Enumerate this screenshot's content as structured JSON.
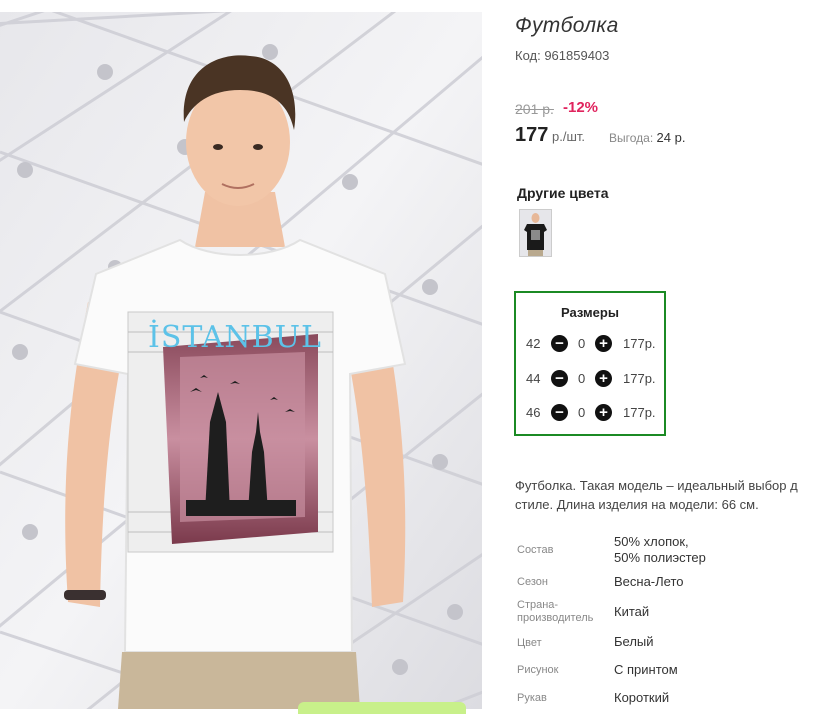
{
  "product": {
    "title": "Футболка",
    "code": "Код: 961859403"
  },
  "pricing": {
    "old_price": "201 р.",
    "discount": "-12%",
    "price": "177",
    "unit": "р./шт.",
    "benefit_label": "Выгода:",
    "benefit_value": "24 р."
  },
  "colors": {
    "title": "Другие цвета",
    "swatches": [
      "black-tshirt"
    ]
  },
  "sizes": {
    "title": "Размеры",
    "rows": [
      {
        "size": "42",
        "qty": "0",
        "price": "177р."
      },
      {
        "size": "44",
        "qty": "0",
        "price": "177р."
      },
      {
        "size": "46",
        "qty": "0",
        "price": "177р."
      }
    ],
    "minus_icon": "−",
    "plus_icon": "+",
    "border_color": "#1b8a24"
  },
  "description": {
    "line1": "Футболка. Такая модель – идеальный выбор д",
    "line2": "стиле. Длина изделия на модели: 66 см."
  },
  "attributes": [
    {
      "label": "Состав",
      "value1": "50% хлопок,",
      "value2": "50% полиэстер"
    },
    {
      "label": "Сезон",
      "value1": "Весна-Лето"
    },
    {
      "label1": "Страна-",
      "label2": "производитель",
      "value1": "Китай"
    },
    {
      "label": "Цвет",
      "value1": "Белый"
    },
    {
      "label": "Рисунок",
      "value1": "С принтом"
    },
    {
      "label": "Рукав",
      "value1": "Короткий"
    }
  ],
  "photo": {
    "print_text": "İSTANBUL"
  },
  "accent_colors": {
    "discount": "#e0245e",
    "sizes_border": "#1b8a24"
  }
}
